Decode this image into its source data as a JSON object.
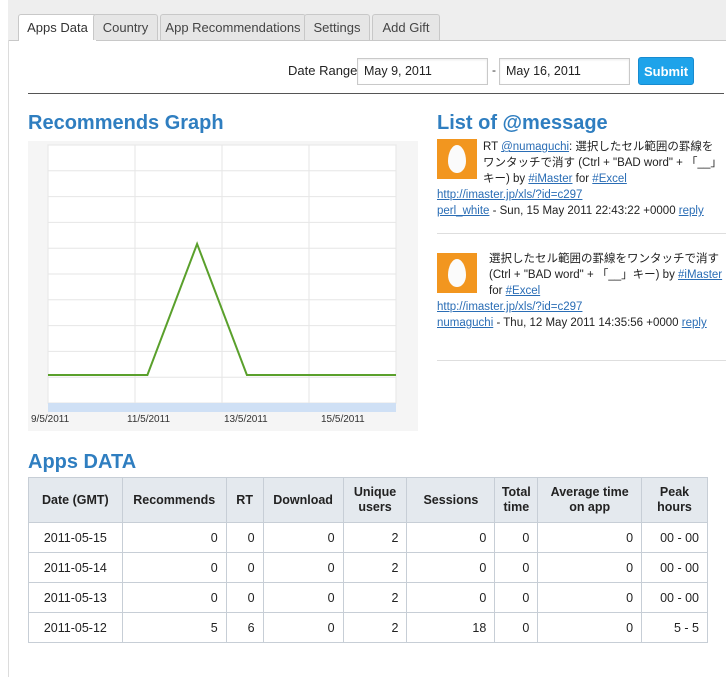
{
  "tabs": [
    {
      "label": "Apps Data",
      "active": true
    },
    {
      "label": "Country",
      "active": false
    },
    {
      "label": "App Recommendations",
      "active": false
    },
    {
      "label": "Settings",
      "active": false
    },
    {
      "label": "Add Gift",
      "active": false
    }
  ],
  "date_range": {
    "label": "Date Range",
    "start": "May 9, 2011",
    "separator": "-",
    "end": "May 16, 2011",
    "submit": "Submit"
  },
  "graph": {
    "title": "Recommends Graph"
  },
  "chart_data": {
    "type": "line",
    "title": "",
    "xlabel": "",
    "ylabel": "",
    "x": [
      "9/5/2011",
      "10/5/2011",
      "11/5/2011",
      "12/5/2011",
      "13/5/2011",
      "14/5/2011",
      "15/5/2011",
      "16/5/2011"
    ],
    "values": [
      0,
      0,
      0,
      5,
      0,
      0,
      0,
      0
    ],
    "x_tick_labels": [
      "9/5/2011",
      "11/5/2011",
      "13/5/2011",
      "15/5/2011"
    ],
    "color": "#5aa02c",
    "grid": true
  },
  "messages_section": {
    "title": "List of @message"
  },
  "messages": [
    {
      "prefix": "RT ",
      "mention": "@numaguchi",
      "text": ": 選択したセル範囲の罫線をワンタッチで消す (Ctrl + \"BAD word\" + 「__」キー) by ",
      "tag1": "#iMaster",
      "mid": " for ",
      "tag2": "#Excel",
      "link": "http://imaster.jp/xls/?id=c297",
      "user": "perl_white",
      "timestamp": " - Sun, 15 May 2011 22:43:22 +0000 ",
      "reply": "reply"
    },
    {
      "prefix": "",
      "mention": "",
      "text": "選択したセル範囲の罫線をワンタッチで消す (Ctrl + \"BAD word\" + 「__」キー) by ",
      "tag1": "#iMaster",
      "mid": " for ",
      "tag2": "#Excel",
      "link": "http://imaster.jp/xls/?id=c297",
      "user": "numaguchi",
      "timestamp": " - Thu, 12 May 2011 14:35:56 +0000 ",
      "reply": "reply"
    }
  ],
  "apps_data": {
    "title": "Apps DATA",
    "columns": [
      "Date (GMT)",
      "Recommends",
      "RT",
      "Download",
      "Unique users",
      "Sessions",
      "Total time",
      "Average time on app",
      "Peak hours"
    ],
    "rows": [
      [
        "2011-05-15",
        "0",
        "0",
        "0",
        "2",
        "0",
        "0",
        "0",
        "00 - 00"
      ],
      [
        "2011-05-14",
        "0",
        "0",
        "0",
        "2",
        "0",
        "0",
        "0",
        "00 - 00"
      ],
      [
        "2011-05-13",
        "0",
        "0",
        "0",
        "2",
        "0",
        "0",
        "0",
        "00 - 00"
      ],
      [
        "2011-05-12",
        "5",
        "6",
        "0",
        "2",
        "18",
        "0",
        "0",
        "5 - 5"
      ]
    ]
  },
  "colors": {
    "accent": "#2f7ec0",
    "button": "#1ea3ea",
    "line": "#5aa02c",
    "avatar": "#f2961f"
  }
}
